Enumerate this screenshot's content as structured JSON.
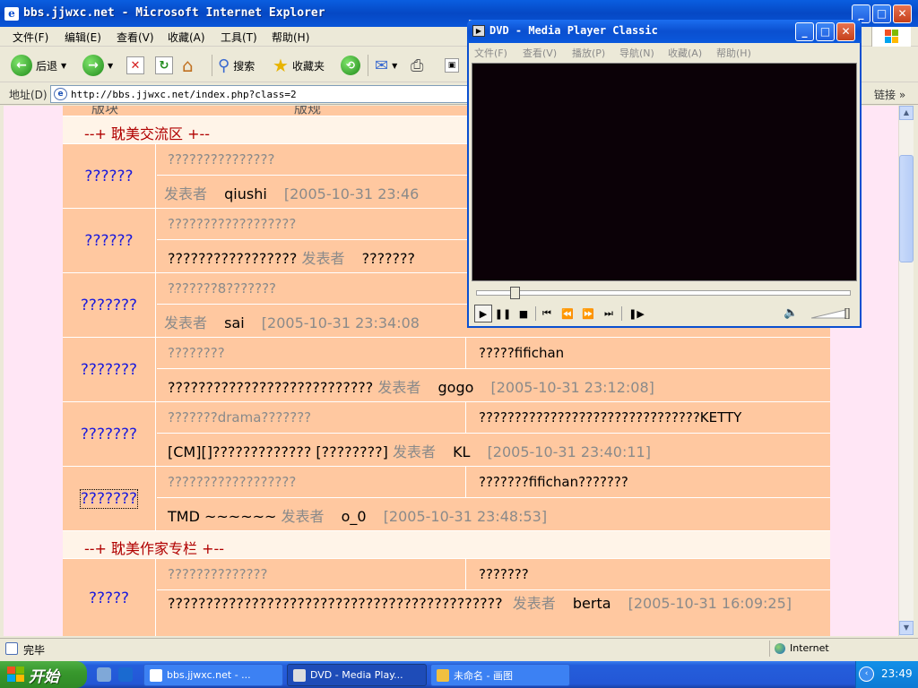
{
  "ie": {
    "title": "bbs.jjwxc.net - Microsoft Internet Explorer",
    "title_icon": "e",
    "menu": [
      "文件(F)",
      "编辑(E)",
      "查看(V)",
      "收藏(A)",
      "工具(T)",
      "帮助(H)"
    ],
    "toolbar": {
      "back_label": "后退",
      "search_label": "搜索",
      "favorites_label": "收藏夹"
    },
    "address": {
      "label": "地址(D)",
      "url": "http://bbs.jjwxc.net/index.php?class=2",
      "links_label": "链接"
    },
    "status": {
      "text": "完毕",
      "zone": "Internet"
    }
  },
  "forum": {
    "header": {
      "col1": "版块",
      "col2": "版规"
    },
    "sections": [
      {
        "label": "--+  耽美交流区  +--"
      },
      {
        "label": "--+  耽美作家专栏  +--"
      }
    ],
    "boards": [
      {
        "name": "??????",
        "top_left": "???????????????",
        "top_right": "",
        "bottom": {
          "prefix": "",
          "label": "发表者",
          "poster": "qiushi",
          "time": "[2005-10-31 23:46"
        }
      },
      {
        "name": "??????",
        "top_left": "??????????????????",
        "top_right": "",
        "bottom": {
          "prefix": "?????????????????",
          "label": "发表者",
          "poster": "???????",
          "time": ""
        }
      },
      {
        "name": "???????",
        "top_left": "???????8???????",
        "top_right": "",
        "bottom": {
          "prefix": "",
          "label": "发表者",
          "poster": "sai",
          "time": "[2005-10-31 23:34:08"
        }
      },
      {
        "name": "???????",
        "top_left": "????????",
        "top_right": "?????fifichan",
        "bottom": {
          "prefix": "???????????????????????????",
          "label": "发表者",
          "poster": "gogo",
          "time": "[2005-10-31 23:12:08]"
        }
      },
      {
        "name": "???????",
        "top_left": "???????drama???????",
        "top_right": "???????????????????????????????KETTY",
        "bottom": {
          "prefix": "[CM][]????????????? [????????]",
          "label": "发表者",
          "poster": "KL",
          "time": "[2005-10-31 23:40:11]"
        }
      },
      {
        "name": "???????",
        "top_left": "??????????????????",
        "top_right": "???????fifichan???????",
        "bottom": {
          "prefix": "TMD ~~~~~~",
          "label": "发表者",
          "poster": "o_0",
          "time": "[2005-10-31 23:48:53]"
        }
      },
      {
        "name": "?????",
        "top_left": "??????????????",
        "top_right": "???????",
        "bottom": {
          "prefix": "????????????????????????????????????????????",
          "label": "发表者",
          "poster": "berta",
          "time": "[2005-10-31 16:09:25]"
        }
      }
    ]
  },
  "mpc": {
    "title": "DVD - Media Player Classic",
    "menu": [
      "文件(F)",
      "查看(V)",
      "播放(P)",
      "导航(N)",
      "收藏(A)",
      "帮助(H)"
    ],
    "seek_position": 0.09,
    "volume_level": 0.95
  },
  "taskbar": {
    "start_label": "开始",
    "tasks": [
      {
        "label": "bbs.jjwxc.net - ...",
        "icon": "ie-icon"
      },
      {
        "label": "DVD - Media Play...",
        "icon": "mpc-icon"
      },
      {
        "label": "未命名 - 画图",
        "icon": "paint-icon"
      }
    ],
    "clock": "23:49"
  },
  "colors": {
    "board_bg": "#ffc8a0",
    "section_text": "#b00000",
    "board_link": "#1a1adc",
    "page_bg": "#ffe6f5"
  }
}
